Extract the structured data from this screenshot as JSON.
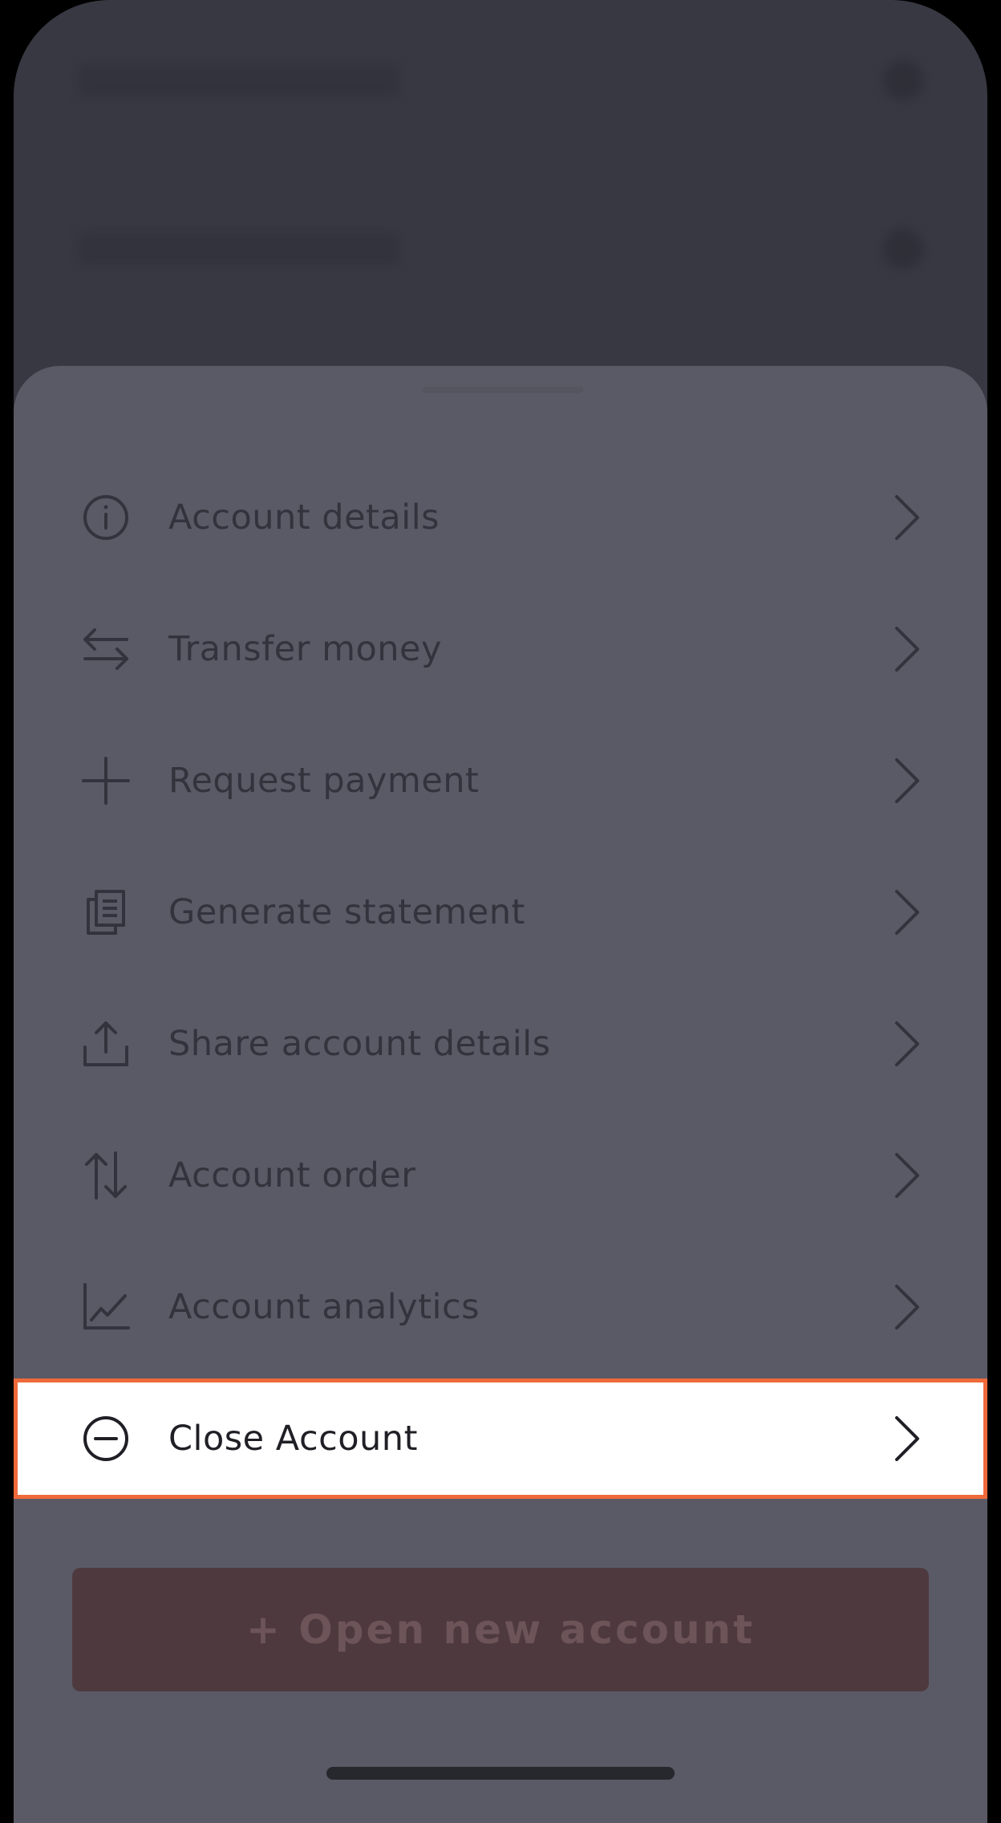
{
  "menu": {
    "items": [
      {
        "label": "Account details",
        "icon": "info-icon"
      },
      {
        "label": "Transfer money",
        "icon": "transfer-arrows-icon"
      },
      {
        "label": "Request payment",
        "icon": "plus-icon"
      },
      {
        "label": "Generate statement",
        "icon": "documents-icon"
      },
      {
        "label": "Share account details",
        "icon": "share-upload-icon"
      },
      {
        "label": "Account order",
        "icon": "sort-arrows-icon"
      },
      {
        "label": "Account analytics",
        "icon": "chart-icon"
      },
      {
        "label": "Close Account",
        "icon": "minus-circle-icon",
        "highlighted": true
      }
    ]
  },
  "actions": {
    "open_new_account": "+ Open new account"
  },
  "colors": {
    "sheet": "#5a5a66",
    "background": "#383843",
    "highlight_border": "#ef6a3a",
    "button": "#4e3a3e"
  }
}
